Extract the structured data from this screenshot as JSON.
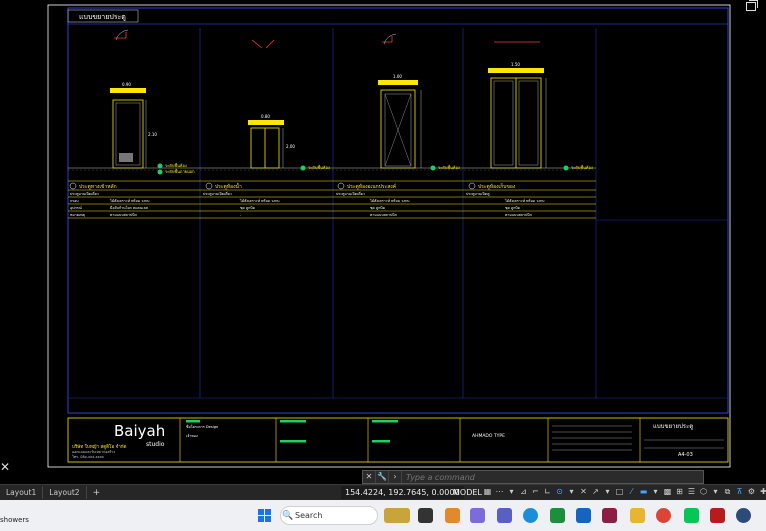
{
  "drawing": {
    "sheet_title": "แบบขยายประตู",
    "door_labels": [
      "ประตูทางเข้าหลัก",
      "ประตูห้องน้ำ",
      "ประตูห้องอเนกประสงค์",
      "ประตูห้องเก็บของ"
    ],
    "dim_labels": [
      "0.90",
      "2.10",
      "0.80",
      "2.00",
      "1.00",
      "1.50"
    ],
    "level_marks": [
      "ระดับพื้นห้อง",
      "ระดับพื้นภายนอก",
      "ระดับพื้นห้อง",
      "ระดับพื้นห้อง",
      "ระดับพื้นห้อง"
    ],
    "schedule": {
      "row_labels": [
        "วัสดุ",
        "กรอบ",
        "อุปกรณ์",
        "หมายเหตุ"
      ],
      "col_text": [
        [
          "ประตูบานเปิดเดี่ยว",
          "ไม้สังเคราะห์ พร้อม วงกบ",
          "มือจับก้านโยก สแตนเลส",
          "ตามแบบสถาปนิก"
        ],
        [
          "ประตูบานเปิดเดี่ยว",
          "ไม้สังเคราะห์ พร้อม วงกบ",
          "ชุด ลูกบิด",
          "-"
        ],
        [
          "ประตูบานเปิดเดี่ยว",
          "ไม้สังเคราะห์ พร้อม วงกบ",
          "ชุด ลูกบิด",
          "ตามแบบสถาปนิก"
        ],
        [
          "ประตูบานเปิดคู่",
          "ไม้สังเคราะห์ พร้อม วงกบ",
          "ชุด ลูกบิด",
          "ตามแบบสถาปนิก"
        ]
      ]
    },
    "title_block": {
      "brand": "Baiyah",
      "brand_sub": "studio",
      "company": "บริษัท ใบหญ้า สตูดิโอ จำกัด",
      "company_lines": [
        "ออกแบบและรับเหมาก่อสร้าง",
        "โทร. 08x-xxx-xxxx"
      ],
      "project_label": "ชื่อโครงการ Design",
      "owner_label": "เจ้าของ",
      "sheet_name": "แบบขยายประตู",
      "sheet_no": "A4-03",
      "mid_text": "AHMADO TYPE"
    }
  },
  "window": {
    "close_glyph": "✕"
  },
  "command": {
    "placeholder": "Type a command",
    "close_glyph": "✕",
    "wrench_glyph": "🔧"
  },
  "statusbar": {
    "tabs": [
      "Layout1",
      "Layout2"
    ],
    "add_tab": "+",
    "coords": "154.4224, 192.7645, 0.0000",
    "mode": "MODEL"
  },
  "taskbar": {
    "weather": "showers",
    "search_label": "Search",
    "search_icon": "🔍"
  }
}
